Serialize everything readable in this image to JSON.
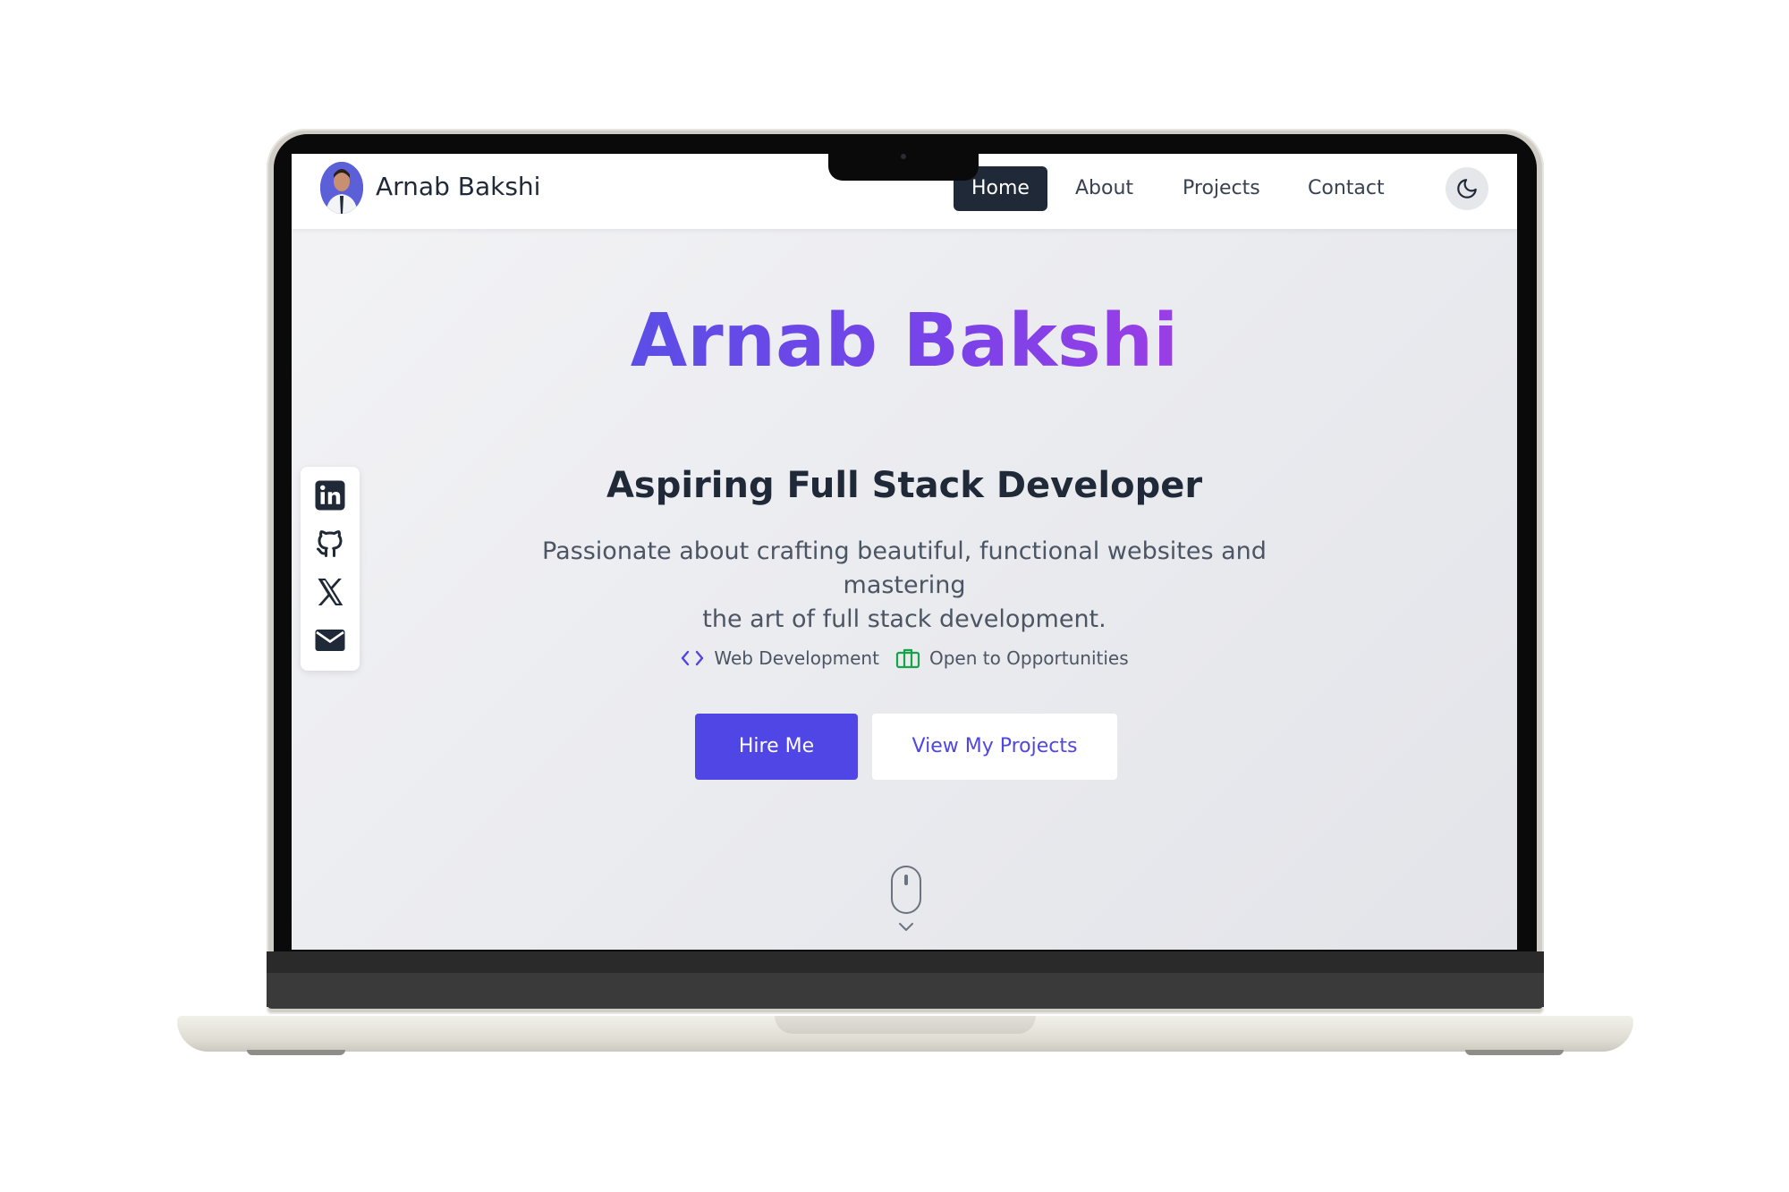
{
  "navbar": {
    "brand_name": "Arnab Bakshi",
    "items": [
      {
        "label": "Home",
        "active": true
      },
      {
        "label": "About",
        "active": false
      },
      {
        "label": "Projects",
        "active": false
      },
      {
        "label": "Contact",
        "active": false
      }
    ],
    "theme_toggle_icon": "moon-icon"
  },
  "social_links": [
    {
      "icon": "linkedin-icon"
    },
    {
      "icon": "github-icon"
    },
    {
      "icon": "x-twitter-icon"
    },
    {
      "icon": "email-icon"
    }
  ],
  "hero": {
    "name": "Arnab Bakshi",
    "subtitle": "Aspiring Full Stack Developer",
    "description_line1": "Passionate about crafting beautiful, functional websites and mastering",
    "description_line2": "the art of full stack development.",
    "tags": [
      {
        "icon": "code-icon",
        "label": "Web Development",
        "color": "#4f46e5"
      },
      {
        "icon": "briefcase-icon",
        "label": "Open to Opportunities",
        "color": "#16a34a"
      }
    ],
    "primary_button": "Hire Me",
    "secondary_button": "View My Projects",
    "scroll_indicator_icon": "mouse-scroll-icon"
  },
  "colors": {
    "accent": "#5046e5",
    "gradient_start": "#5b4ee6",
    "gradient_end": "#9b3ee6",
    "nav_active_bg": "#1f2937"
  }
}
